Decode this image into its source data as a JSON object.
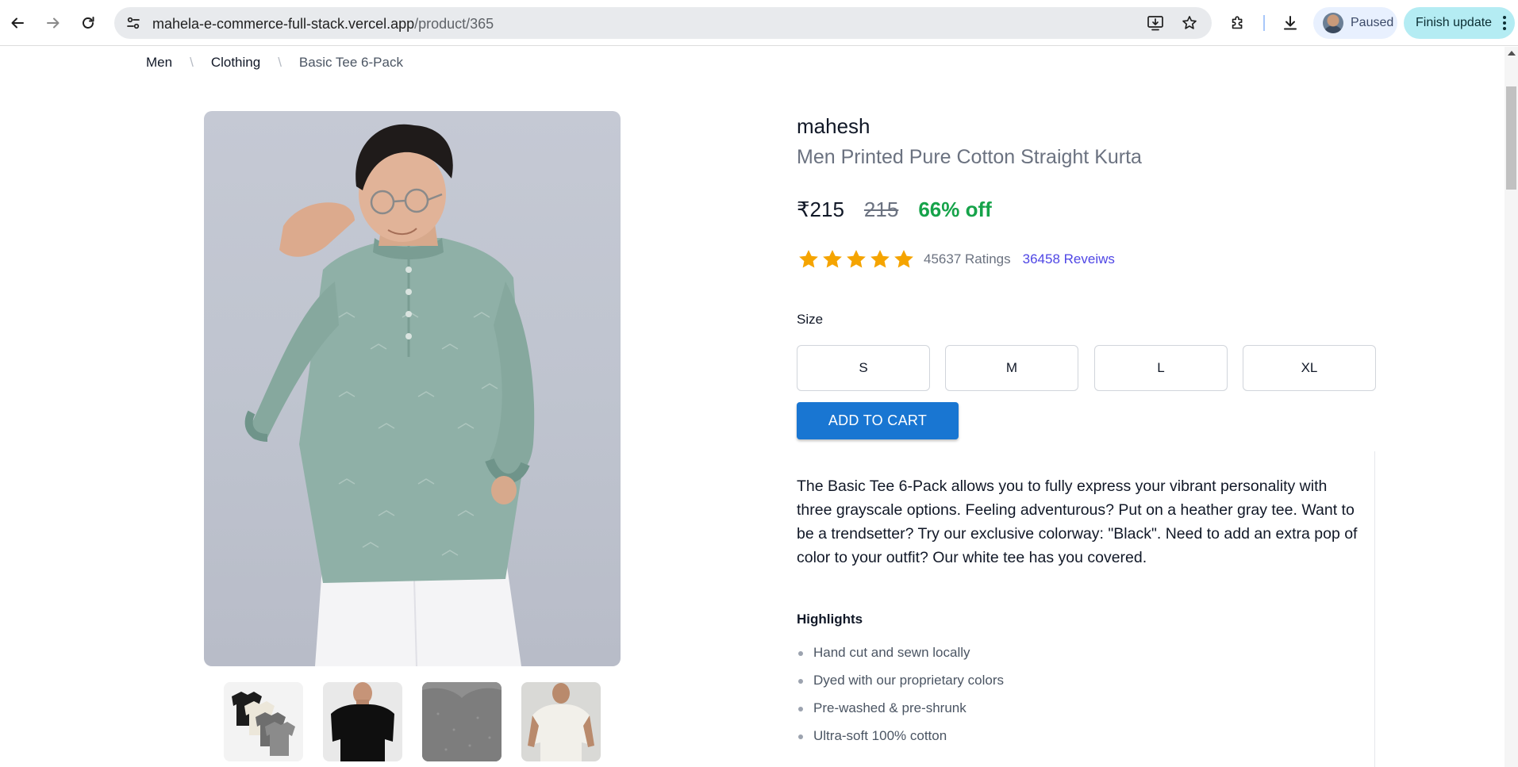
{
  "browser": {
    "url_host": "mahela-e-commerce-full-stack.vercel.app",
    "url_path": "/product/365",
    "profile_status": "Paused",
    "update_label": "Finish update"
  },
  "breadcrumb": {
    "items": [
      "Men",
      "Clothing"
    ],
    "separator": "\\",
    "current": "Basic Tee 6-Pack"
  },
  "product": {
    "brand": "mahesh",
    "title": "Men Printed Pure Cotton Straight Kurta",
    "price": "₹215",
    "mrp": "215",
    "discount": "66% off",
    "rating_value": 5,
    "rating_max": 5,
    "ratings_text": "45637 Ratings",
    "reviews_text": "36458 Reveiws",
    "size_label": "Size",
    "sizes": [
      "S",
      "M",
      "L",
      "XL"
    ],
    "add_to_cart": "ADD TO CART",
    "description": "The Basic Tee 6-Pack allows you to fully express your vibrant personality with three grayscale options. Feeling adventurous? Put on a heather gray tee. Want to be a trendsetter? Try our exclusive colorway: \"Black\". Need to add an extra pop of color to your outfit? Our white tee has you covered.",
    "highlights_title": "Highlights",
    "highlights": [
      "Hand cut and sewn locally",
      "Dyed with our proprietary colors",
      "Pre-washed & pre-shrunk",
      "Ultra-soft 100% cotton"
    ]
  },
  "colors": {
    "discount_green": "#16a34a",
    "star_amber": "#f5a400",
    "link_indigo": "#4f46e5",
    "cart_blue": "#1976d2"
  },
  "icons": {
    "back": "arrow-left-icon",
    "forward": "arrow-right-icon",
    "reload": "reload-icon",
    "site_info": "tune-icon",
    "install": "install-app-icon",
    "bookmark": "star-outline-icon",
    "extensions": "puzzle-icon",
    "downloads": "download-icon",
    "menu": "kebab-icon"
  }
}
